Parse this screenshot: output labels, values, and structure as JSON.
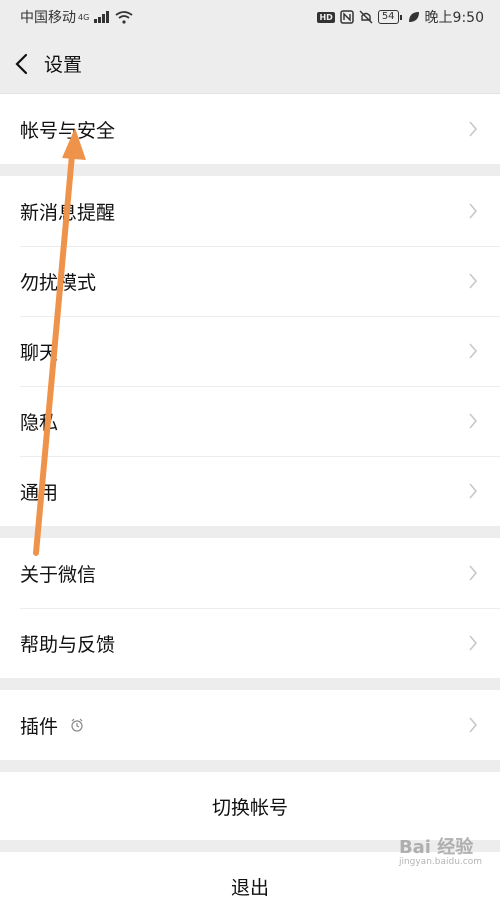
{
  "status_bar": {
    "carrier": "中国移动",
    "network": "4G",
    "hd_badge": "HD",
    "battery": "54",
    "time": "晚上9:50"
  },
  "nav": {
    "title": "设置"
  },
  "groups": [
    {
      "items": [
        {
          "label": "帐号与安全"
        }
      ]
    },
    {
      "items": [
        {
          "label": "新消息提醒"
        },
        {
          "label": "勿扰模式"
        },
        {
          "label": "聊天"
        },
        {
          "label": "隐私"
        },
        {
          "label": "通用"
        }
      ]
    },
    {
      "items": [
        {
          "label": "关于微信"
        },
        {
          "label": "帮助与反馈"
        }
      ]
    },
    {
      "items": [
        {
          "label": "插件"
        }
      ]
    }
  ],
  "actions": {
    "switch_account": "切换帐号",
    "logout": "退出"
  },
  "watermark": {
    "text": "Bai 经验",
    "sub": "jingyan.baidu.com"
  },
  "colors": {
    "annotation_arrow": "#f0934a",
    "background": "#ededed"
  }
}
